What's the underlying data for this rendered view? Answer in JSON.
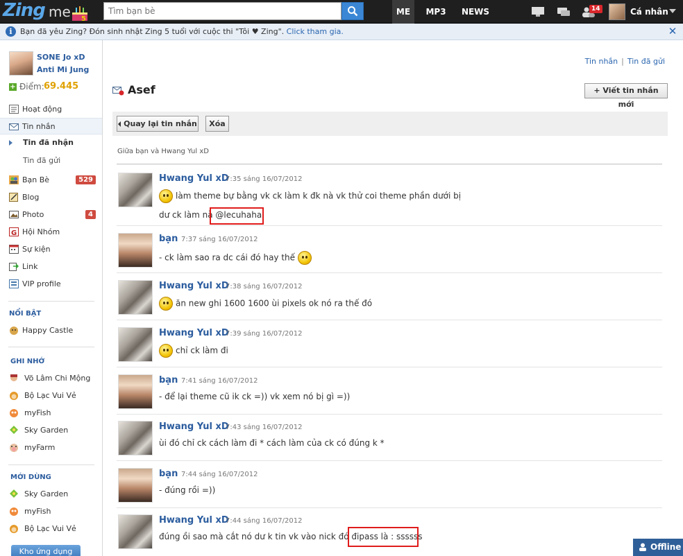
{
  "topbar": {
    "logo_text": "Zing",
    "logo_me": "me",
    "search_placeholder": "Tìm bạn bè",
    "tabs": [
      "ME",
      "MP3",
      "NEWS"
    ],
    "notif_count": "14",
    "user_label": "Cá nhân"
  },
  "notice": {
    "text": "Bạn đã yêu Zing? Đón sinh nhật Zing 5 tuổi với cuộc thi \"Tôi ♥ Zing\".",
    "link": "Click tham gia."
  },
  "sidebar": {
    "name1": "SONE Jo xD",
    "name2": "Anti Mi Jung",
    "points_label": "Điểm:",
    "points_value": "69.445",
    "items": [
      {
        "label": "Hoạt động"
      },
      {
        "label": "Tin nhắn"
      }
    ],
    "sub_items": [
      {
        "label": "Tin đã nhận"
      },
      {
        "label": "Tin đã gửi"
      }
    ],
    "items2": [
      {
        "label": "Bạn Bè",
        "count": "529"
      },
      {
        "label": "Blog"
      },
      {
        "label": "Photo",
        "count": "4"
      },
      {
        "label": "Hội Nhóm"
      },
      {
        "label": "Sự kiện"
      },
      {
        "label": "Link"
      },
      {
        "label": "VIP profile"
      }
    ],
    "section_featured": "NỔI BẬT",
    "featured": [
      {
        "label": "Happy Castle"
      }
    ],
    "section_saved": "GHI NHỚ",
    "saved": [
      {
        "label": "Võ Lâm Chi Mộng"
      },
      {
        "label": "Bộ Lạc Vui Vẻ"
      },
      {
        "label": "myFish"
      },
      {
        "label": "Sky Garden"
      },
      {
        "label": "myFarm"
      }
    ],
    "section_new": "MỚI DÙNG",
    "new_used": [
      {
        "label": "Sky Garden"
      },
      {
        "label": "myFish"
      },
      {
        "label": "Bộ Lạc Vui Vẻ"
      }
    ],
    "app_store_button": "Kho ứng dụng"
  },
  "main": {
    "top_links": [
      "Tin nhắn",
      "Tin đã gửi"
    ],
    "title": "Asef",
    "new_message_button": "+ Viết tin nhắn mới",
    "back_button": "Quay lại tin nhắn",
    "delete_button": "Xóa",
    "between": "Giữa bạn và Hwang Yul xD",
    "messages": [
      {
        "name": "Hwang Yul xD",
        "time": "7:35 sáng 16/07/2012",
        "line1": "làm theme bự bằng vk ck làm k đk nà vk thử coi theme phần dưới bị",
        "line2": "dư ck làm nà",
        "highlight": "@lecuhaha"
      },
      {
        "name": "bạn",
        "time": "7:37 sáng 16/07/2012",
        "line1": "- ck làm sao ra dc cái đó hay thế"
      },
      {
        "name": "Hwang Yul xD",
        "time": "7:38 sáng 16/07/2012",
        "line1": "ăn new ghi 1600 1600 ùi pixels ok nó ra thế đó"
      },
      {
        "name": "Hwang Yul xD",
        "time": "7:39 sáng 16/07/2012",
        "line1": "chỉ ck làm đi"
      },
      {
        "name": "bạn",
        "time": "7:41 sáng 16/07/2012",
        "line1": "- để lại theme cũ ik ck =)) vk xem nó bị gì =))"
      },
      {
        "name": "Hwang Yul xD",
        "time": "7:43 sáng 16/07/2012",
        "line1": "ùi đó chỉ ck cách làm đi * cách làm của ck có đúng k *"
      },
      {
        "name": "bạn",
        "time": "7:44 sáng 16/07/2012",
        "line1": "- đúng rồi =))"
      },
      {
        "name": "Hwang Yul xD",
        "time": "7:44 sáng 16/07/2012",
        "line1": "đúng ồi sao mà cắt nó dư k tin vk vào nick đó đi",
        "highlight": "pass là : ssssss"
      }
    ]
  },
  "offline_label": "Offline",
  "colors": {
    "topbar": "#1f1f1f",
    "link": "#2b5c9e",
    "accent": "#3b87d6",
    "highlight": "#e01b1b"
  }
}
